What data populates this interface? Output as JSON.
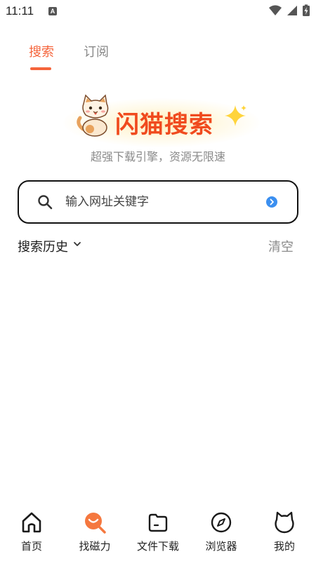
{
  "status_bar": {
    "time": "11:11",
    "keyboard_indicator": "A"
  },
  "tabs": [
    {
      "label": "搜索",
      "active": true
    },
    {
      "label": "订阅",
      "active": false
    }
  ],
  "brand": {
    "title": "闪猫搜索",
    "slogan": "超强下载引擎，资源无限速"
  },
  "search": {
    "placeholder": "输入网址关键字",
    "value": ""
  },
  "history": {
    "title": "搜索历史",
    "clear_label": "清空"
  },
  "bottom_nav": [
    {
      "label": "首页",
      "icon": "home-icon"
    },
    {
      "label": "找磁力",
      "icon": "magnet-search-icon"
    },
    {
      "label": "文件下载",
      "icon": "folder-icon"
    },
    {
      "label": "浏览器",
      "icon": "compass-icon"
    },
    {
      "label": "我的",
      "icon": "cat-head-icon"
    }
  ],
  "colors": {
    "accent": "#f5643b",
    "brand_red": "#f04a1e",
    "muted_text": "#8a8a8a",
    "go_button": "#3b8ff0"
  }
}
